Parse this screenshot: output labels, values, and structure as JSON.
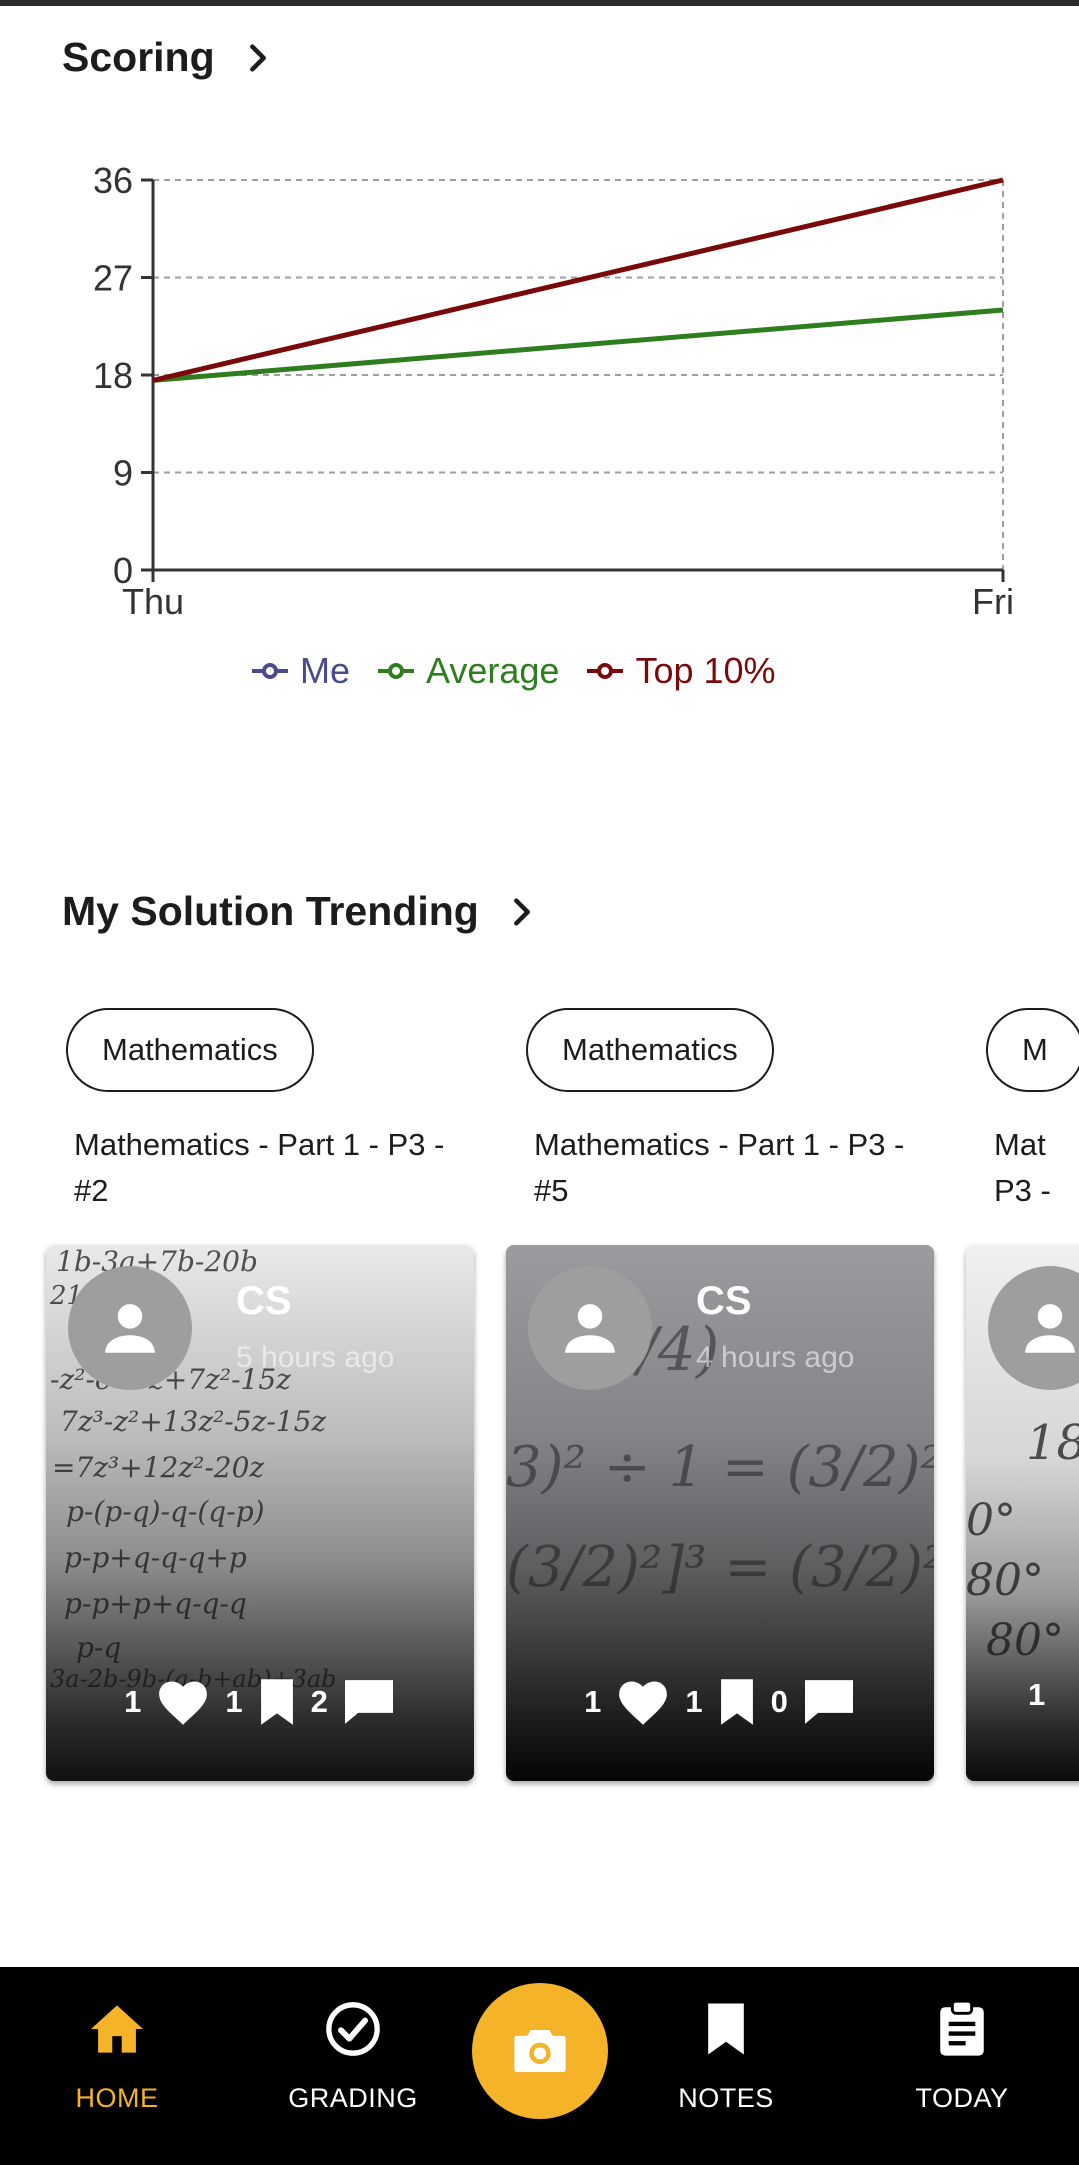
{
  "scoring": {
    "title": "Scoring"
  },
  "chart_data": {
    "type": "line",
    "categories": [
      "Thu",
      "Fri"
    ],
    "yticks": [
      0,
      9,
      18,
      27,
      36
    ],
    "ylim": [
      0,
      36
    ],
    "grid": true,
    "legend_position": "bottom",
    "series": [
      {
        "name": "Me",
        "color": "#4b4a8f",
        "values": [
          null,
          null
        ]
      },
      {
        "name": "Average",
        "color": "#2e7d1e",
        "values": [
          17.5,
          24
        ]
      },
      {
        "name": "Top 10%",
        "color": "#7a0a0a",
        "values": [
          17.5,
          36
        ]
      }
    ]
  },
  "trending": {
    "title": "My Solution Trending",
    "cards": [
      {
        "subject": "Mathematics",
        "title": "Mathematics - Part 1 - P3 - #2",
        "author": "CS",
        "time": "5 hours ago",
        "likes": "1",
        "saves": "1",
        "comments": "2"
      },
      {
        "subject": "Mathematics",
        "title": "Mathematics - Part 1 - P3 - #5",
        "author": "CS",
        "time": "4 hours ago",
        "likes": "1",
        "saves": "1",
        "comments": "0"
      },
      {
        "subject": "M",
        "title": "Mat",
        "title2": "P3 -",
        "likes": "1"
      }
    ]
  },
  "nav": {
    "home": "HOME",
    "grading": "GRADING",
    "notes": "NOTES",
    "today": "TODAY",
    "camera_icon": "camera-icon",
    "accent": "#f5b32a"
  }
}
